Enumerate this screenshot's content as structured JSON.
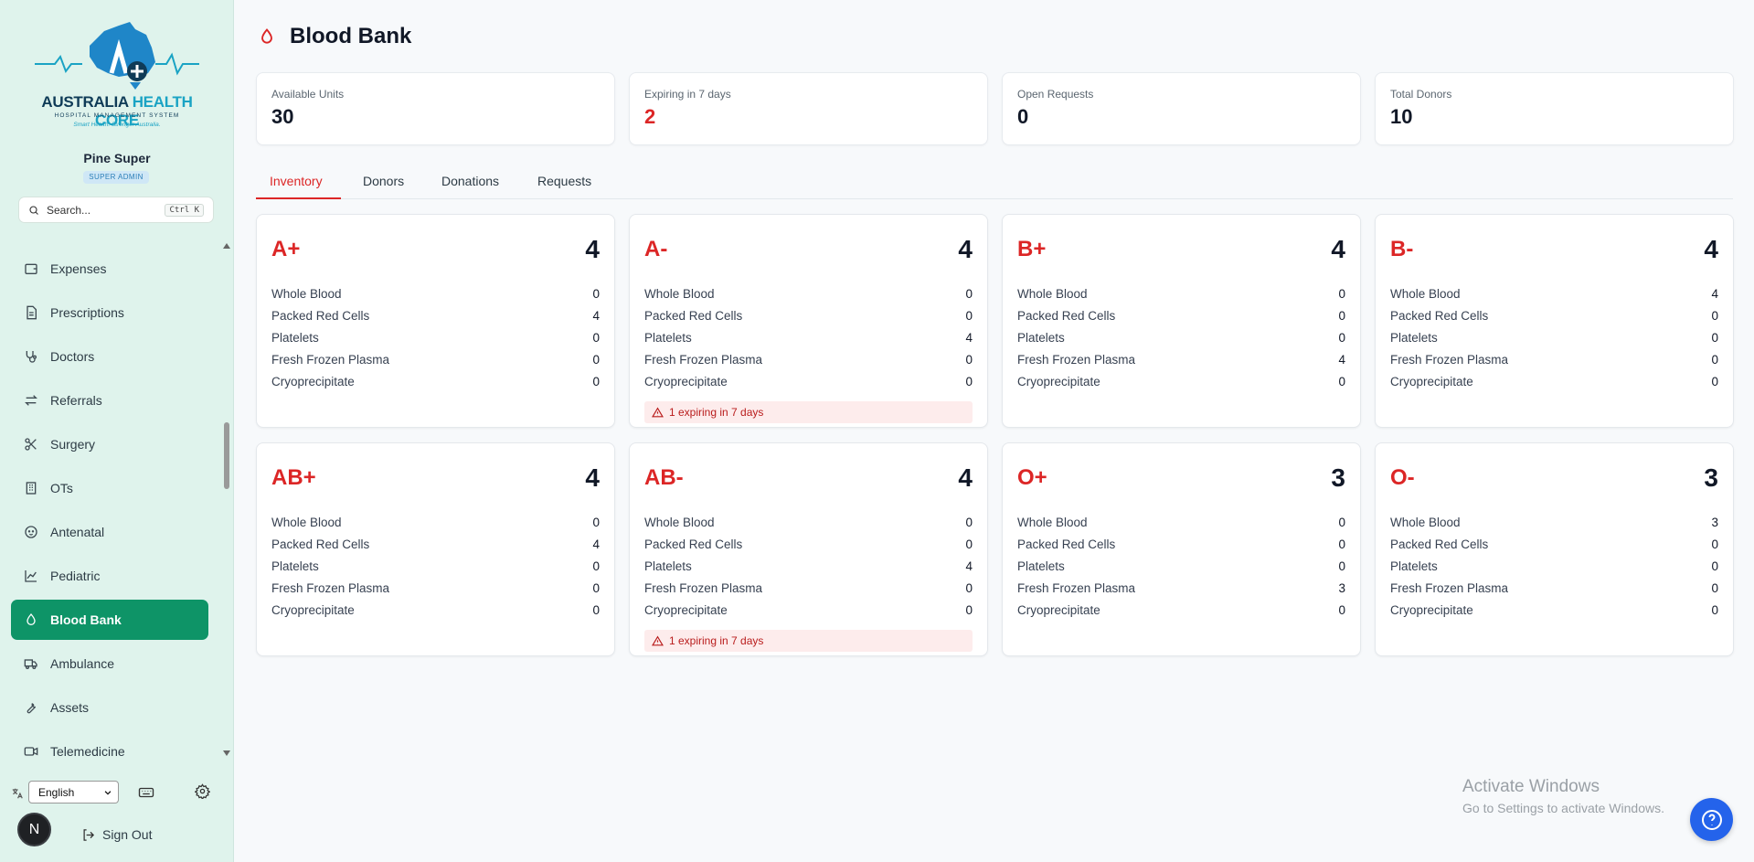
{
  "sidebar": {
    "logo": {
      "line1a": "AUSTRALIA ",
      "line1b": "HEALTH CORE",
      "line2": "HOSPITAL MANAGEMENT SYSTEM",
      "line3": "Smart Health. Stronger Australia."
    },
    "user": {
      "name": "Pine Super",
      "role": "SUPER ADMIN"
    },
    "search": {
      "placeholder": "Search...",
      "shortcut": "Ctrl K"
    },
    "items": [
      {
        "label": "Expenses",
        "icon": "wallet-icon"
      },
      {
        "label": "Prescriptions",
        "icon": "file-text-icon"
      },
      {
        "label": "Doctors",
        "icon": "stethoscope-icon"
      },
      {
        "label": "Referrals",
        "icon": "arrows-exchange-icon"
      },
      {
        "label": "Surgery",
        "icon": "scissors-icon"
      },
      {
        "label": "OTs",
        "icon": "building-icon"
      },
      {
        "label": "Antenatal",
        "icon": "baby-icon"
      },
      {
        "label": "Pediatric",
        "icon": "chart-line-icon"
      },
      {
        "label": "Blood Bank",
        "icon": "droplet-icon",
        "active": true
      },
      {
        "label": "Ambulance",
        "icon": "truck-icon"
      },
      {
        "label": "Assets",
        "icon": "wrench-icon"
      },
      {
        "label": "Telemedicine",
        "icon": "video-icon"
      }
    ],
    "language": "English",
    "avatar_letter": "N",
    "signout": "Sign Out"
  },
  "page": {
    "title": "Blood Bank"
  },
  "stats": [
    {
      "label": "Available Units",
      "value": "30"
    },
    {
      "label": "Expiring in 7 days",
      "value": "2",
      "alert": true
    },
    {
      "label": "Open Requests",
      "value": "0"
    },
    {
      "label": "Total Donors",
      "value": "10"
    }
  ],
  "tabs": [
    {
      "label": "Inventory",
      "active": true
    },
    {
      "label": "Donors"
    },
    {
      "label": "Donations"
    },
    {
      "label": "Requests"
    }
  ],
  "components": [
    "Whole Blood",
    "Packed Red Cells",
    "Platelets",
    "Fresh Frozen Plasma",
    "Cryoprecipitate"
  ],
  "groups": [
    {
      "group": "A+",
      "total": "4",
      "values": [
        "0",
        "4",
        "0",
        "0",
        "0"
      ],
      "warning": ""
    },
    {
      "group": "A-",
      "total": "4",
      "values": [
        "0",
        "0",
        "4",
        "0",
        "0"
      ],
      "warning": "1 expiring in 7 days"
    },
    {
      "group": "B+",
      "total": "4",
      "values": [
        "0",
        "0",
        "0",
        "4",
        "0"
      ],
      "warning": ""
    },
    {
      "group": "B-",
      "total": "4",
      "values": [
        "4",
        "0",
        "0",
        "0",
        "0"
      ],
      "warning": ""
    },
    {
      "group": "AB+",
      "total": "4",
      "values": [
        "0",
        "4",
        "0",
        "0",
        "0"
      ],
      "warning": ""
    },
    {
      "group": "AB-",
      "total": "4",
      "values": [
        "0",
        "0",
        "4",
        "0",
        "0"
      ],
      "warning": "1 expiring in 7 days"
    },
    {
      "group": "O+",
      "total": "3",
      "values": [
        "0",
        "0",
        "0",
        "3",
        "0"
      ],
      "warning": ""
    },
    {
      "group": "O-",
      "total": "3",
      "values": [
        "3",
        "0",
        "0",
        "0",
        "0"
      ],
      "warning": ""
    }
  ],
  "watermark": {
    "line1": "Activate Windows",
    "line2": "Go to Settings to activate Windows."
  },
  "colors": {
    "accent_red": "#dc2626",
    "active_nav": "#0e9467",
    "sidebar_bg": "#dff3ec",
    "help_button": "#2463eb"
  }
}
